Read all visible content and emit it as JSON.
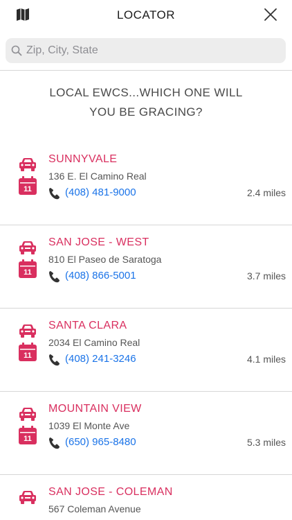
{
  "header": {
    "title": "LOCATOR",
    "map_icon": "map-icon",
    "close_icon": "close-icon"
  },
  "search": {
    "placeholder": "Zip, City, State",
    "value": ""
  },
  "headline": {
    "line1": "LOCAL EWCS...WHICH ONE WILL",
    "line2": "YOU BE GRACING?"
  },
  "colors": {
    "accent": "#d92f5f",
    "link": "#1a73e8"
  },
  "locations": [
    {
      "name": "SUNNYVALE",
      "address": "136 E. El Camino Real",
      "phone": "(408) 481-9000",
      "distance": "2.4 miles",
      "calendar_day": "11"
    },
    {
      "name": "SAN JOSE - WEST",
      "address": "810 El Paseo de Saratoga",
      "phone": "(408) 866-5001",
      "distance": "3.7 miles",
      "calendar_day": "11"
    },
    {
      "name": "SANTA CLARA",
      "address": "2034 El Camino Real",
      "phone": "(408) 241-3246",
      "distance": "4.1 miles",
      "calendar_day": "11"
    },
    {
      "name": "MOUNTAIN VIEW",
      "address": "1039 El Monte Ave",
      "phone": "(650) 965-8480",
      "distance": "5.3 miles",
      "calendar_day": "11"
    },
    {
      "name": "SAN JOSE - COLEMAN",
      "address": "567 Coleman Avenue"
    }
  ]
}
